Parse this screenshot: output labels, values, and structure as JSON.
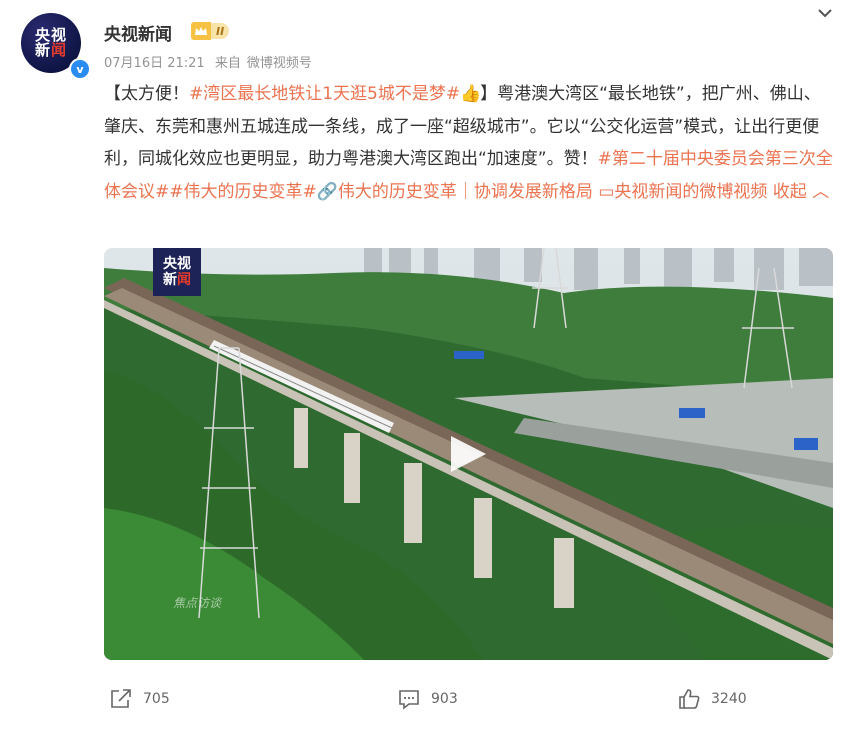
{
  "author": {
    "avatar_line1": "央视",
    "avatar_line2a": "新",
    "avatar_line2b": "闻",
    "name": "央视新闻",
    "vip_level": "II",
    "verified_mark": "v"
  },
  "meta": {
    "time": "07月16日 21:21",
    "source_prefix": "来自",
    "source": "微博视频号"
  },
  "post": {
    "part1": "【太方便！",
    "tag1": "#湾区最长地铁让1天逛5城不是梦#",
    "emoji": "👍",
    "part2": "】粤港澳大湾区“最长地铁”，把广州、佛山、肇庆、东莞和惠州五城连成一条线，成了一座“超级城市”。它以“公交化运营”模式，让出行更便利，同城化效应也更明显，助力粤港澳大湾区跑出“加速度”。赞！",
    "tag2": "#第二十届中央委员会第三次全体会议#",
    "tag3": "#伟大的历史变革#",
    "link_text": "🔗伟大的历史变革｜协调发展新格局",
    "video_link": "央视新闻的微博视频",
    "collapse": "收起"
  },
  "video": {
    "badge_line1": "央视",
    "badge_line2a": "新",
    "badge_line2b": "闻",
    "watermark": "焦点访谈"
  },
  "footer": {
    "share_count": "705",
    "comment_count": "903",
    "like_count": "3240"
  },
  "icons": {
    "more": "chevron-down-icon",
    "play": "play-icon",
    "share": "share-icon",
    "comment": "comment-icon",
    "like": "like-icon"
  },
  "colors": {
    "tag": "#eb7350",
    "verified": "#2a8cf0",
    "avatar_bg": "#0f1545"
  }
}
